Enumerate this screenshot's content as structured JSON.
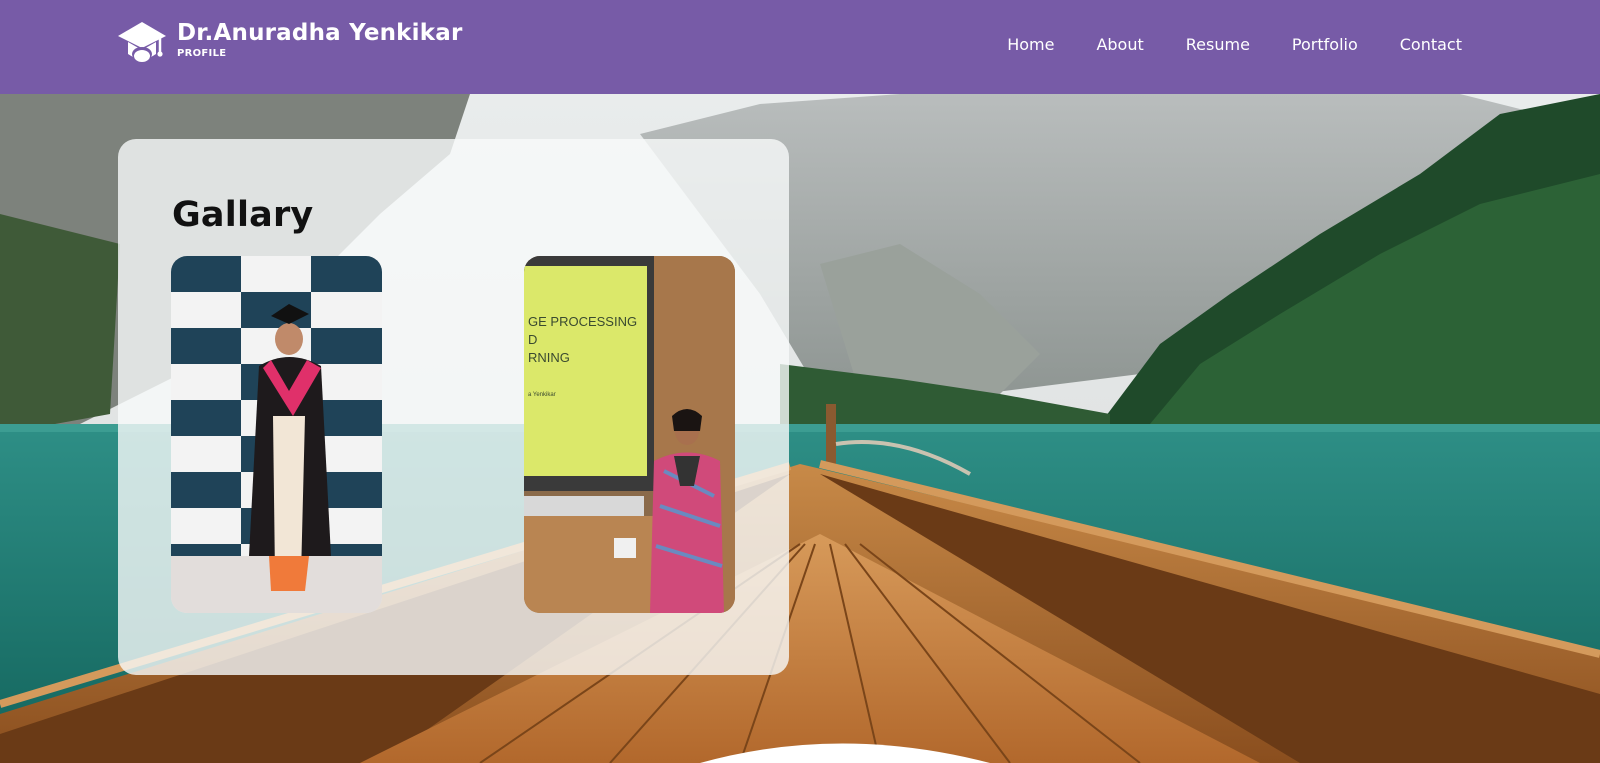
{
  "header": {
    "name": "Dr.Anuradha Yenkikar",
    "subtitle": "PROFILE"
  },
  "nav": {
    "items": [
      "Home",
      "About",
      "Resume",
      "Portfolio",
      "Contact"
    ]
  },
  "gallery": {
    "title": "Gallary",
    "photo_2_slide_lines": [
      "GE PROCESSING",
      "D",
      "RNING"
    ],
    "photo_2_slide_author": "a Yenkikar"
  },
  "colors": {
    "header_bg": "#775ba7",
    "lake": "#1f7f76",
    "forest": "#1f4a2a"
  }
}
